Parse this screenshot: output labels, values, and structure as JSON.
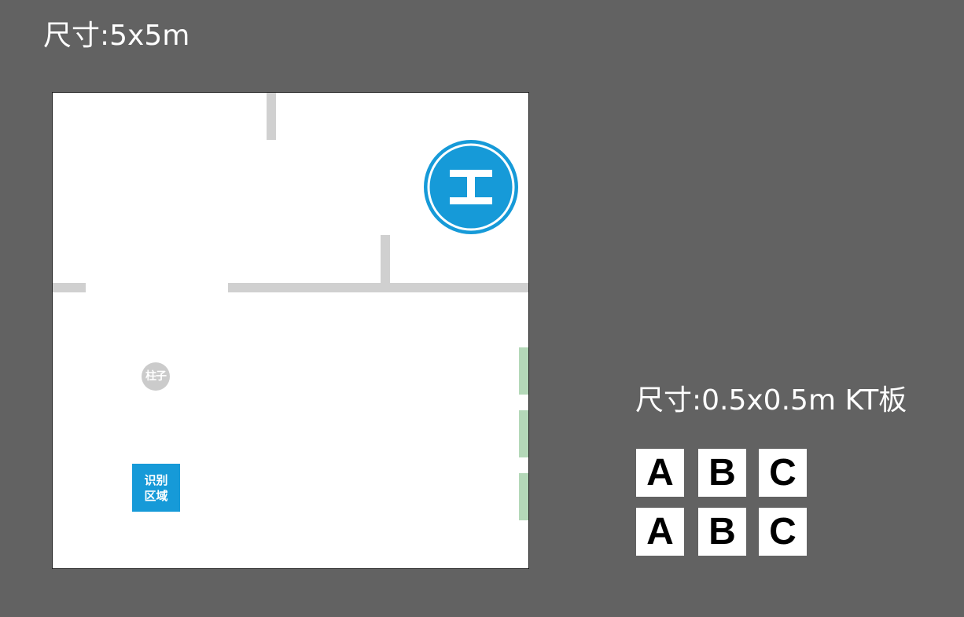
{
  "field": {
    "size_label": "尺寸:5x5m",
    "pillar_label": "柱子",
    "recognition_zone": {
      "line1": "识别",
      "line2": "区域"
    },
    "helipad_icon": "helipad-h-icon",
    "colors": {
      "background": "#626262",
      "floor": "#ffffff",
      "wall": "#d0d0d0",
      "accent_blue": "#169ad8",
      "green_strip": "#b4d8b8",
      "pillar": "#cbcbcb"
    }
  },
  "kt_boards": {
    "size_label": "尺寸:0.5x0.5m  KT板",
    "rows": [
      [
        "A",
        "B",
        "C"
      ],
      [
        "A",
        "B",
        "C"
      ]
    ]
  }
}
